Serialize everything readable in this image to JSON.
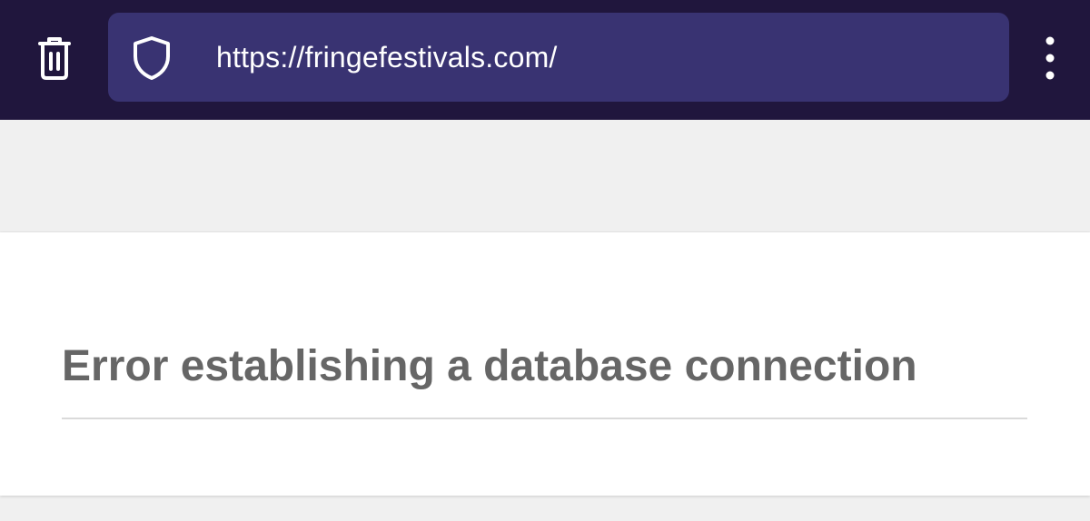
{
  "browser": {
    "url": "https://fringefestivals.com/",
    "icons": {
      "delete": "trash-icon",
      "security": "shield-icon",
      "menu": "kebab-menu-icon"
    },
    "colors": {
      "toolbar": "#20163d",
      "urlbar": "#393372"
    }
  },
  "page": {
    "error_heading": "Error establishing a database connection"
  }
}
